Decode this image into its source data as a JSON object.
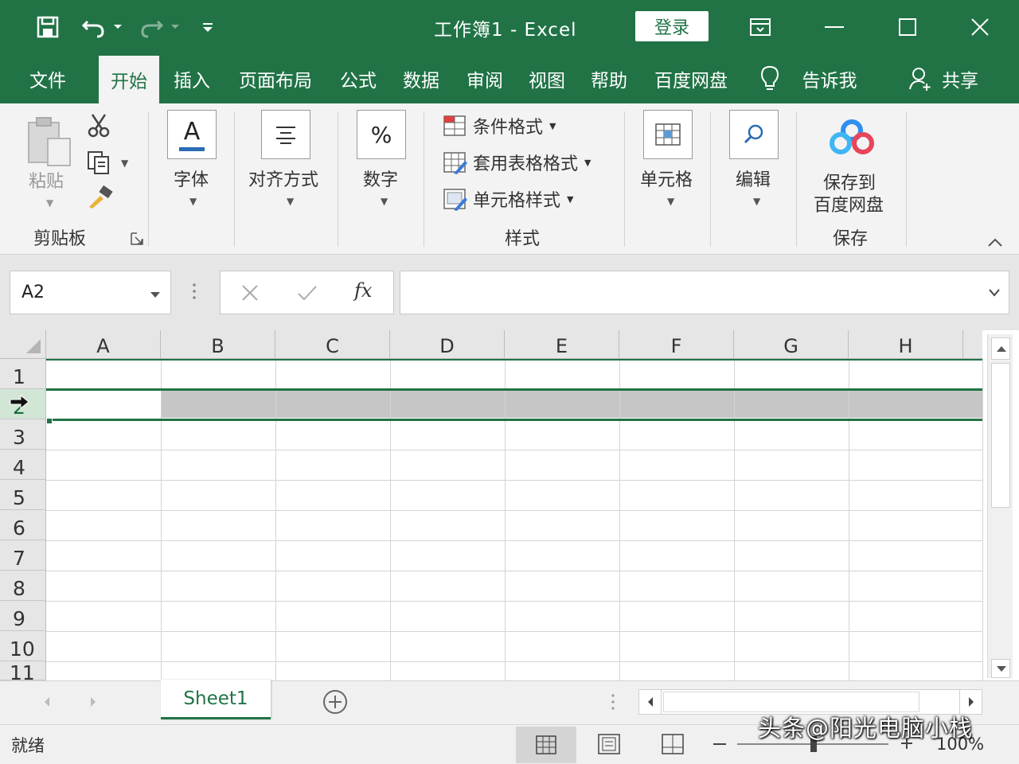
{
  "titlebar": {
    "title": "工作簿1  -  Excel",
    "login_label": "登录"
  },
  "tabs": [
    {
      "label": "文件"
    },
    {
      "label": "开始"
    },
    {
      "label": "插入"
    },
    {
      "label": "页面布局"
    },
    {
      "label": "公式"
    },
    {
      "label": "数据"
    },
    {
      "label": "审阅"
    },
    {
      "label": "视图"
    },
    {
      "label": "帮助"
    },
    {
      "label": "百度网盘"
    },
    {
      "label": "告诉我"
    },
    {
      "label": "共享"
    }
  ],
  "ribbon": {
    "paste_label": "粘贴",
    "clipboard_label": "剪贴板",
    "font_label": "字体",
    "font_glyph": "A",
    "align_label": "对齐方式",
    "number_label": "数字",
    "number_glyph": "%",
    "cond_format_label": "条件格式",
    "table_format_label": "套用表格格式",
    "cell_style_label": "单元格样式",
    "styles_label": "样式",
    "cells_label": "单元格",
    "editing_label": "编辑",
    "save_to_line1": "保存到",
    "save_to_line2": "百度网盘",
    "save_group_label": "保存"
  },
  "formula_bar": {
    "name_box": "A2",
    "fx_glyph": "fx",
    "formula_value": ""
  },
  "grid": {
    "columns": [
      "A",
      "B",
      "C",
      "D",
      "E",
      "F",
      "G",
      "H"
    ],
    "rows": [
      "1",
      "2",
      "3",
      "4",
      "5",
      "6",
      "7",
      "8",
      "9",
      "10",
      "11"
    ],
    "active_cell": "A2",
    "selected_row": "2"
  },
  "sheets": {
    "tabs": [
      {
        "label": "Sheet1"
      }
    ]
  },
  "status": {
    "text": "就绪",
    "zoom": "100%"
  },
  "watermark": "头条@阳光电脑小栈",
  "colors": {
    "accent": "#217346",
    "selection": "#c6c6c6"
  }
}
